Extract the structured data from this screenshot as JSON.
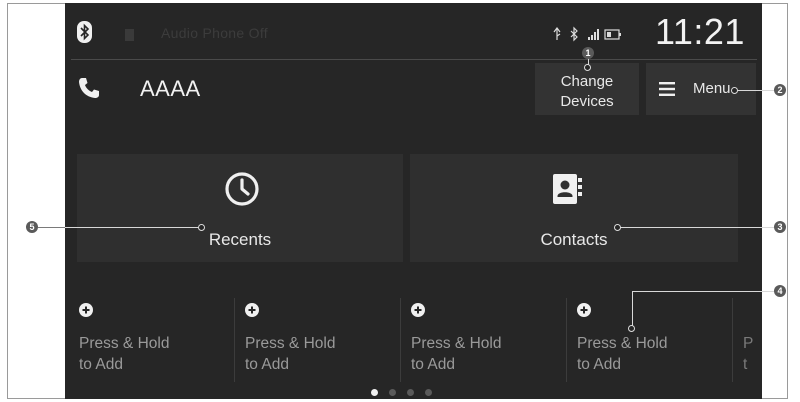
{
  "status_bar": {
    "source": "Audio Phone Off",
    "time": "11:21"
  },
  "phone": {
    "device_name": "AAAA",
    "change_devices_label_line1": "Change",
    "change_devices_label_line2": "Devices",
    "menu_label": "Menu"
  },
  "tiles": {
    "recents_label": "Recents",
    "contacts_label": "Contacts"
  },
  "speed_dial": [
    {
      "line1": "Press & Hold",
      "line2": "to Add"
    },
    {
      "line1": "Press & Hold",
      "line2": "to Add"
    },
    {
      "line1": "Press & Hold",
      "line2": "to Add"
    },
    {
      "line1": "Press & Hold",
      "line2": "to Add"
    }
  ],
  "speed_dial_partial": {
    "line1": "P",
    "line2": "t"
  },
  "pagination": {
    "pages": 4,
    "current": 1
  },
  "callouts": [
    "1",
    "2",
    "3",
    "4",
    "5"
  ],
  "colors": {
    "screen_bg": "#262626",
    "button_bg": "#333333",
    "tile_bg": "#2f2f2f",
    "text_light": "#e8e8e8",
    "text_dim": "#9a9a9a"
  },
  "icons": [
    "bluetooth-icon",
    "phone-icon",
    "menu-icon",
    "clock-icon",
    "contacts-book-icon",
    "plus-circle-icon",
    "usb-icon",
    "signal-icon",
    "battery-icon"
  ]
}
